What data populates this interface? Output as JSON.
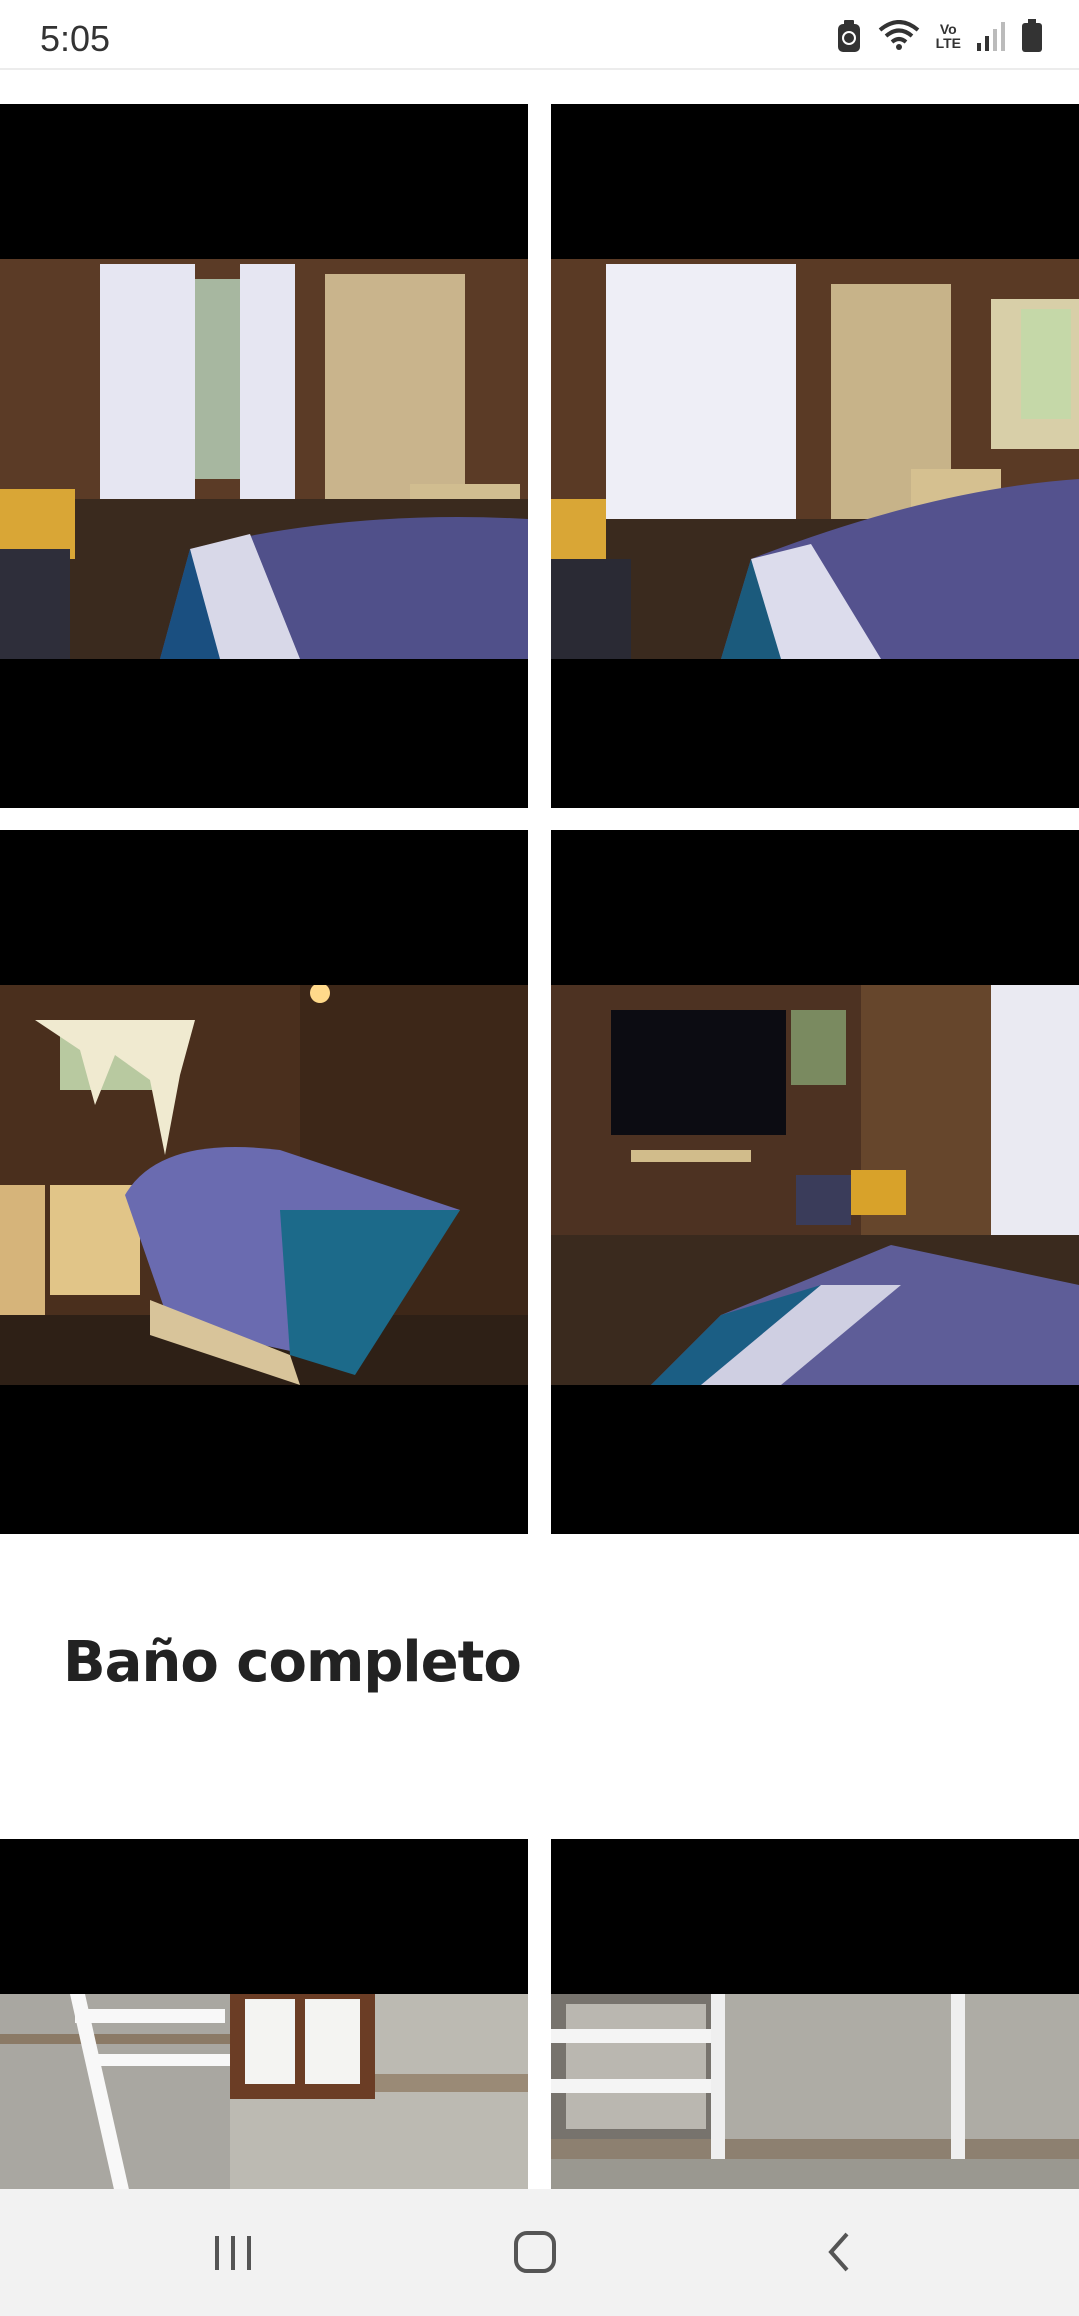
{
  "status_bar": {
    "time": "5:05",
    "icons": [
      "data-saver-icon",
      "wifi-icon",
      "volte-icon",
      "signal-icon",
      "battery-icon"
    ],
    "volte_top": "Vo",
    "volte_bottom": "LTE"
  },
  "gallery": {
    "bedroom_photos": [
      {
        "name": "photo-bedroom-1"
      },
      {
        "name": "photo-bedroom-2"
      },
      {
        "name": "photo-bedroom-3"
      },
      {
        "name": "photo-bedroom-4"
      }
    ]
  },
  "section": {
    "title": "Baño completo"
  },
  "bathroom_photos": [
    {
      "name": "photo-bathroom-1"
    },
    {
      "name": "photo-bathroom-2"
    }
  ],
  "nav_bar": {
    "buttons": [
      "recent-apps-icon",
      "home-icon",
      "back-icon"
    ]
  },
  "colors": {
    "letterbox": "#000000",
    "background": "#ffffff",
    "nav_background": "#f2f2f2"
  }
}
